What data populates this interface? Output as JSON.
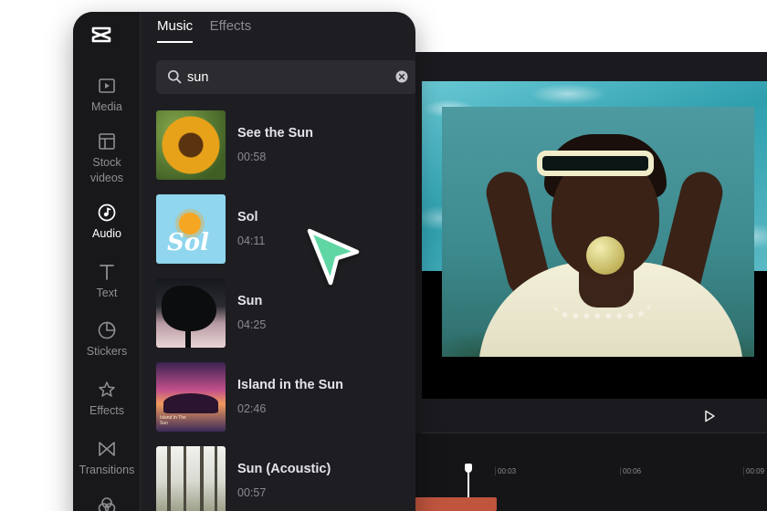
{
  "colors": {
    "accent_cursor": "#5fd6a4",
    "panel_bg": "#1e1e22",
    "rail_bg": "#18181b",
    "clip_color": "#c0553e"
  },
  "sidebar": {
    "items": [
      {
        "label": "Media",
        "icon": "media-icon"
      },
      {
        "label": "Stock\nvideos",
        "icon": "stock-videos-icon"
      },
      {
        "label": "Audio",
        "icon": "audio-icon",
        "active": true
      },
      {
        "label": "Text",
        "icon": "text-icon"
      },
      {
        "label": "Stickers",
        "icon": "stickers-icon"
      },
      {
        "label": "Effects",
        "icon": "effects-icon"
      },
      {
        "label": "Transitions",
        "icon": "transitions-icon"
      }
    ]
  },
  "tabs": [
    {
      "label": "Music",
      "active": true
    },
    {
      "label": "Effects",
      "active": false
    }
  ],
  "search": {
    "value": "sun"
  },
  "tracks": [
    {
      "title": "See the Sun",
      "duration": "00:58"
    },
    {
      "title": "Sol",
      "duration": "04:11"
    },
    {
      "title": "Sun",
      "duration": "04:25"
    },
    {
      "title": "Island in the Sun",
      "duration": "02:46"
    },
    {
      "title": "Sun (Acoustic)",
      "duration": "00:57"
    }
  ],
  "thumbs": {
    "sol_word": "Sol",
    "island_caption": "Island In The\nSun"
  },
  "timeline": {
    "ticks": [
      "00:03",
      "00:06",
      "00:09"
    ]
  }
}
